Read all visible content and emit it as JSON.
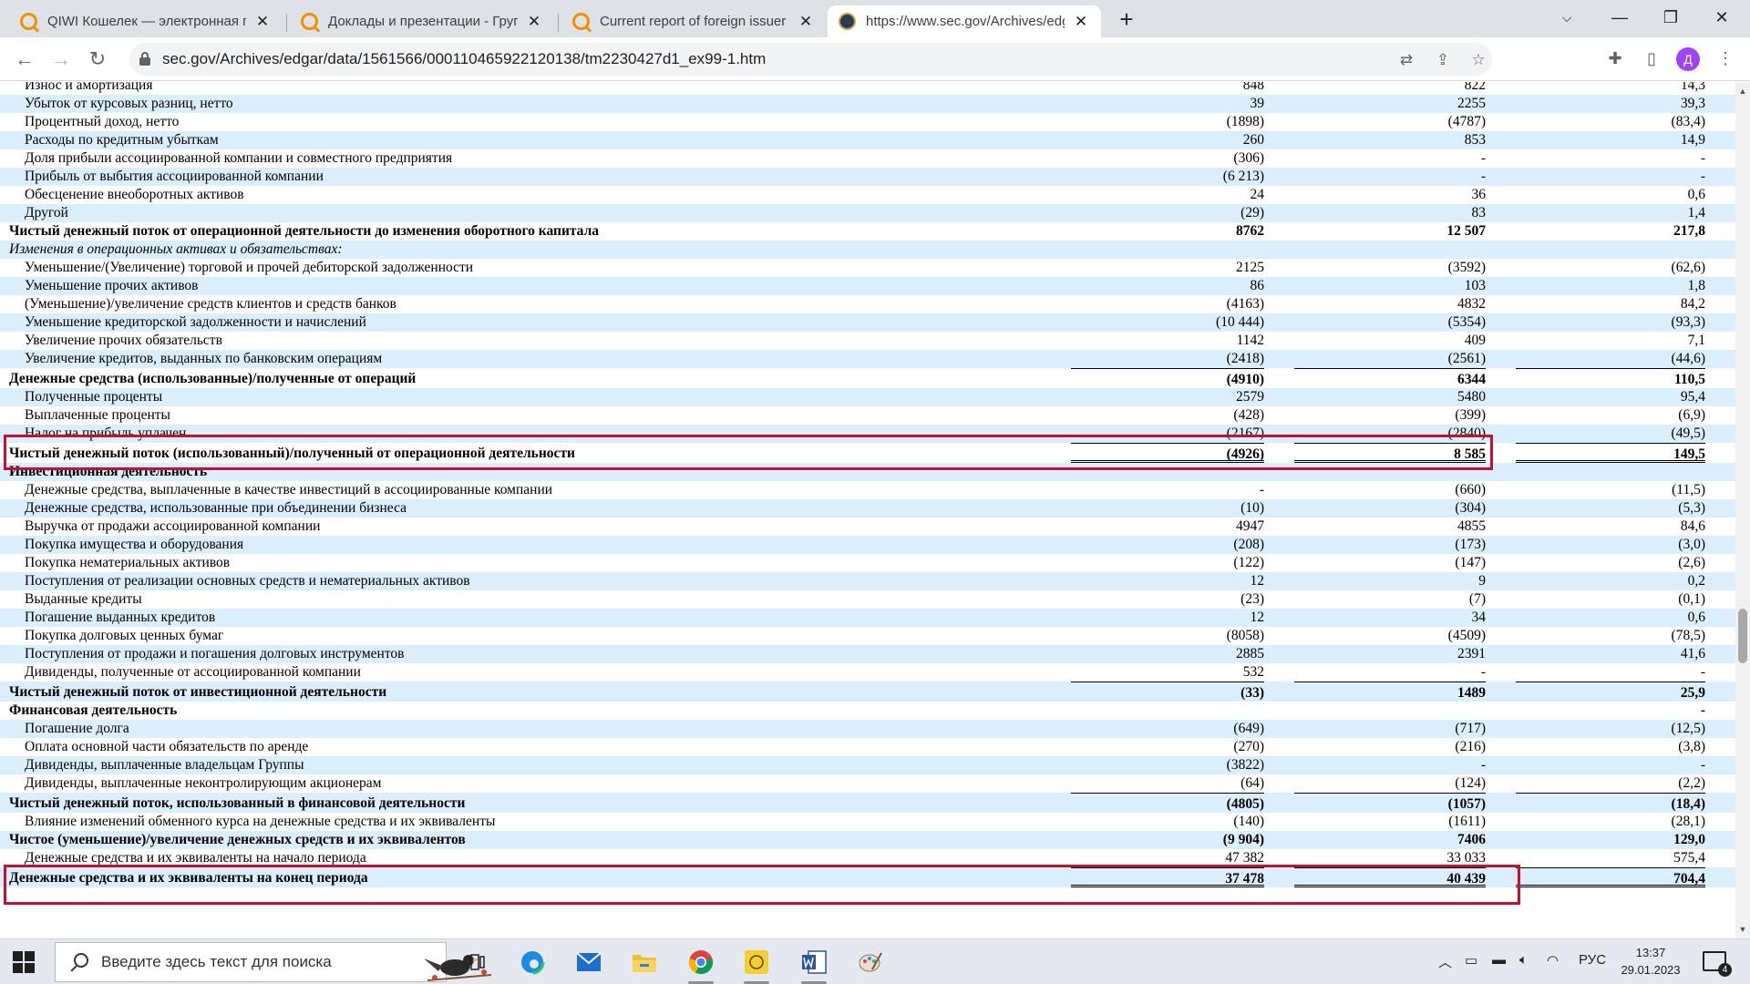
{
  "tabs": [
    {
      "title": "QIWI Кошелек — электронная платежная система",
      "favicon": "qiwi-search-icon"
    },
    {
      "title": "Доклады и презентации - Группа QIWI",
      "favicon": "qiwi-search-icon"
    },
    {
      "title": "Current report of foreign issuer pursuant to rules",
      "favicon": "qiwi-search-icon"
    },
    {
      "title": "https://www.sec.gov/Archives/edgar",
      "favicon": "sec-seal-icon"
    }
  ],
  "active_tab": 3,
  "new_tab_symbol": "+",
  "address_bar": {
    "url": "sec.gov/Archives/edgar/data/1561566/000110465922120138/tm2230427d1_ex99-1.htm"
  },
  "profile_initial": "Д",
  "colors": {
    "row_band": "#dbeefb",
    "annotation": "#c8102e",
    "profile": "#a142f4",
    "tab_strip": "#dee1e6"
  },
  "table": {
    "rows": [
      {
        "label": "Износ и амортизация",
        "v1": "848",
        "v2": "822",
        "v3": "14,3",
        "band": false,
        "indent": true
      },
      {
        "label": "Убыток от курсовых разниц, нетто",
        "v1": "39",
        "v2": "2255",
        "v3": "39,3",
        "band": true,
        "indent": true
      },
      {
        "label": "Процентный доход, нетто",
        "v1": "(1898)",
        "v2": "(4787)",
        "v3": "(83,4)",
        "band": false,
        "indent": true
      },
      {
        "label": "Расходы по кредитным убыткам",
        "v1": "260",
        "v2": "853",
        "v3": "14,9",
        "band": true,
        "indent": true
      },
      {
        "label": "Доля прибыли ассоциированной компании и совместного предприятия",
        "v1": "(306)",
        "v2": "-",
        "v3": "-",
        "band": false,
        "indent": true
      },
      {
        "label": "Прибыль от выбытия ассоциированной компании",
        "v1": "(6 213)",
        "v2": "-",
        "v3": "-",
        "band": true,
        "indent": true
      },
      {
        "label": "Обесценение внеоборотных активов",
        "v1": "24",
        "v2": "36",
        "v3": "0,6",
        "band": false,
        "indent": true
      },
      {
        "label": "Другой",
        "v1": "(29)",
        "v2": "83",
        "v3": "1,4",
        "band": true,
        "indent": true
      },
      {
        "label": "Чистый денежный поток от операционной деятельности до изменения оборотного капитала",
        "v1": "8762",
        "v2": "12 507",
        "v3": "217,8",
        "band": false,
        "bold": true
      },
      {
        "label": "Изменения в операционных активах и обязательствах:",
        "v1": "",
        "v2": "",
        "v3": "",
        "band": true,
        "italic": true
      },
      {
        "label": "Уменьшение/(Увеличение) торговой и прочей дебиторской задолженности",
        "v1": "2125",
        "v2": "(3592)",
        "v3": "(62,6)",
        "band": false,
        "indent": true
      },
      {
        "label": "Уменьшение прочих активов",
        "v1": "86",
        "v2": "103",
        "v3": "1,8",
        "band": true,
        "indent": true
      },
      {
        "label": "(Уменьшение)/увеличение средств клиентов и средств банков",
        "v1": "(4163)",
        "v2": "4832",
        "v3": "84,2",
        "band": false,
        "indent": true
      },
      {
        "label": "Уменьшение кредиторской задолженности и начислений",
        "v1": "(10 444)",
        "v2": "(5354)",
        "v3": "(93,3)",
        "band": true,
        "indent": true
      },
      {
        "label": "Увеличение прочих обязательств",
        "v1": "1142",
        "v2": "409",
        "v3": "7,1",
        "band": false,
        "indent": true
      },
      {
        "label": "Увеличение кредитов, выданных по банковским операциям",
        "v1": "(2418)",
        "v2": "(2561)",
        "v3": "(44,6)",
        "band": true,
        "indent": true
      },
      {
        "label": "Денежные средства (использованные)/полученные от операций",
        "v1": "(4910)",
        "v2": "6344",
        "v3": "110,5",
        "band": false,
        "bold": true,
        "tall": true,
        "underline": true
      },
      {
        "label": "Полученные проценты",
        "v1": "2579",
        "v2": "5480",
        "v3": "95,4",
        "band": true,
        "indent": true
      },
      {
        "label": "Выплаченные проценты",
        "v1": "(428)",
        "v2": "(399)",
        "v3": "(6,9)",
        "band": false,
        "indent": true
      },
      {
        "label": "Налог на прибыль уплачен",
        "v1": "(2167)",
        "v2": "(2840)",
        "v3": "(49,5)",
        "band": true,
        "indent": true
      },
      {
        "label": "Чистый денежный поток (использованный)/полученный от операционной деятельности",
        "v1": "(4926)",
        "v2": "8 585",
        "v3": "149,5",
        "band": false,
        "bold": true,
        "tall": true,
        "underline": true,
        "double": true
      },
      {
        "label": "Инвестиционная деятельность",
        "v1": "",
        "v2": "",
        "v3": "",
        "band": true,
        "bold": true
      },
      {
        "label": "Денежные средства, выплаченные в качестве инвестиций в ассоциированные компании",
        "v1": "-",
        "v2": "(660)",
        "v3": "(11,5)",
        "band": false,
        "indent": true
      },
      {
        "label": "Денежные средства, использованные при объединении бизнеса",
        "v1": "(10)",
        "v2": "(304)",
        "v3": "(5,3)",
        "band": true,
        "indent": true
      },
      {
        "label": "Выручка от продажи ассоциированной компании",
        "v1": "4947",
        "v2": "4855",
        "v3": "84,6",
        "band": false,
        "indent": true
      },
      {
        "label": "Покупка имущества и оборудования",
        "v1": "(208)",
        "v2": "(173)",
        "v3": "(3,0)",
        "band": true,
        "indent": true
      },
      {
        "label": "Покупка нематериальных активов",
        "v1": "(122)",
        "v2": "(147)",
        "v3": "(2,6)",
        "band": false,
        "indent": true
      },
      {
        "label": "Поступления от реализации основных средств и нематериальных активов",
        "v1": "12",
        "v2": "9",
        "v3": "0,2",
        "band": true,
        "indent": true
      },
      {
        "label": "Выданные кредиты",
        "v1": "(23)",
        "v2": "(7)",
        "v3": "(0,1)",
        "band": false,
        "indent": true
      },
      {
        "label": "Погашение выданных кредитов",
        "v1": "12",
        "v2": "34",
        "v3": "0,6",
        "band": true,
        "indent": true
      },
      {
        "label": "Покупка долговых ценных бумаг",
        "v1": "(8058)",
        "v2": "(4509)",
        "v3": "(78,5)",
        "band": false,
        "indent": true
      },
      {
        "label": "Поступления от продажи и погашения долговых инструментов",
        "v1": "2885",
        "v2": "2391",
        "v3": "41,6",
        "band": true,
        "indent": true
      },
      {
        "label": "Дивиденды, полученные от ассоциированной компании",
        "v1": "532",
        "v2": "-",
        "v3": "-",
        "band": false,
        "indent": true
      },
      {
        "label": "Чистый денежный поток от инвестиционной деятельности",
        "v1": "(33)",
        "v2": "1489",
        "v3": "25,9",
        "band": true,
        "bold": true,
        "tall": true,
        "underline": true
      },
      {
        "label": "Финансовая деятельность",
        "v1": "",
        "v2": "",
        "v3": "-",
        "band": false,
        "bold": true
      },
      {
        "label": "Погашение долга",
        "v1": "(649)",
        "v2": "(717)",
        "v3": "(12,5)",
        "band": true,
        "indent": true
      },
      {
        "label": "Оплата основной части обязательств по аренде",
        "v1": "(270)",
        "v2": "(216)",
        "v3": "(3,8)",
        "band": false,
        "indent": true
      },
      {
        "label": "Дивиденды, выплаченные владельцам Группы",
        "v1": "(3822)",
        "v2": "-",
        "v3": "-",
        "band": true,
        "indent": true
      },
      {
        "label": "Дивиденды, выплаченные неконтролирующим акционерам",
        "v1": "(64)",
        "v2": "(124)",
        "v3": "(2,2)",
        "band": false,
        "indent": true
      },
      {
        "label": "Чистый денежный поток, использованный в финансовой деятельности",
        "v1": "(4805)",
        "v2": "(1057)",
        "v3": "(18,4)",
        "band": true,
        "bold": true,
        "tall": true,
        "underline": true
      },
      {
        "label": "Влияние изменений обменного курса на денежные средства и их эквиваленты",
        "v1": "(140)",
        "v2": "(1611)",
        "v3": "(28,1)",
        "band": false,
        "indent": true
      },
      {
        "label": "Чистое (уменьшение)/увеличение денежных средств и их эквивалентов",
        "v1": "(9 904)",
        "v2": "7406",
        "v3": "129,0",
        "band": true,
        "bold": true
      },
      {
        "label": "Денежные средства и их эквиваленты на начало периода",
        "v1": "47 382",
        "v2": "33 033",
        "v3": "575,4",
        "band": false,
        "indent": true
      },
      {
        "label": "Денежные средства и их эквиваленты на конец периода",
        "v1": "37 478",
        "v2": "40 439",
        "v3": "704,4",
        "band": true,
        "bold": true,
        "tall": true,
        "underline": true,
        "double": true
      }
    ]
  },
  "taskbar": {
    "search_placeholder": "Введите здесь текст для поиска",
    "apps": [
      "task-view-icon",
      "edge-icon",
      "mail-icon",
      "file-explorer-icon",
      "chrome-icon",
      "sticky-app-icon",
      "word-icon",
      "paint-icon"
    ],
    "language": "РУС",
    "time": "13:37",
    "date": "29.01.2023",
    "notification_count": "4"
  }
}
